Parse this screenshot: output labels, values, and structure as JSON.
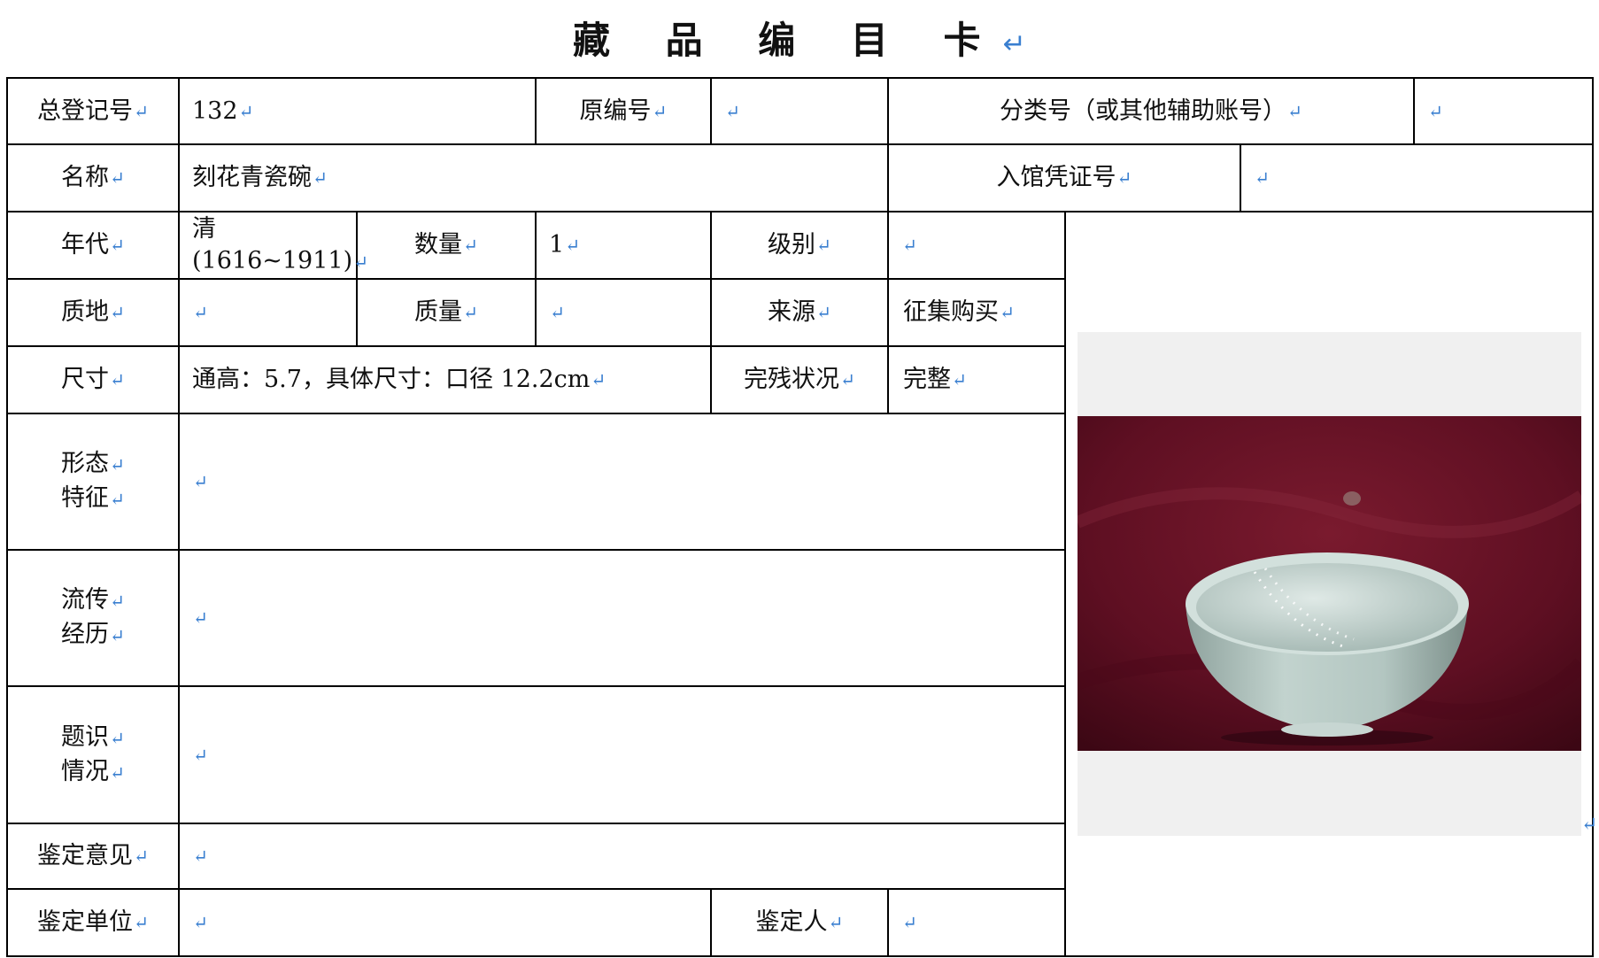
{
  "title": "藏 品 编 目 卡",
  "pilcrow": "↵",
  "rows": {
    "r1": {
      "reg_label": "总登记号",
      "reg_value": "132",
      "orig_label": "原编号",
      "orig_value": "",
      "class_label": "分类号（或其他辅助账号）",
      "class_value": ""
    },
    "r2": {
      "name_label": "名称",
      "name_value": "刻花青瓷碗",
      "voucher_label": "入馆凭证号",
      "voucher_value": ""
    },
    "r3": {
      "era_label": "年代",
      "era_line1": "清",
      "era_line2": "(1616~1911)",
      "qty_label": "数量",
      "qty_value": "1",
      "grade_label": "级别",
      "grade_value": ""
    },
    "r4": {
      "material_label": "质地",
      "material_value": "",
      "weight_label": "质量",
      "weight_value": "",
      "source_label": "来源",
      "source_value": "征集购买"
    },
    "r5": {
      "size_label": "尺寸",
      "size_value": "通高：5.7，具体尺寸：口径 12.2cm",
      "condition_label": "完残状况",
      "condition_value": "完整"
    },
    "r6": {
      "shape_label_1": "形态",
      "shape_label_2": "特征",
      "shape_value": ""
    },
    "r7": {
      "history_label_1": "流传",
      "history_label_2": "经历",
      "history_value": ""
    },
    "r8": {
      "inscr_label_1": "题识",
      "inscr_label_2": "情况",
      "inscr_value": ""
    },
    "r9": {
      "opinion_label": "鉴定意见",
      "opinion_value": ""
    },
    "r10": {
      "unit_label": "鉴定单位",
      "unit_value": "",
      "appraiser_label": "鉴定人",
      "appraiser_value": ""
    }
  },
  "photo": {
    "subject": "celadon-bowl-on-red-cloth",
    "bg_color": "#6b1325",
    "bowl_color": "#b9cbc6"
  }
}
